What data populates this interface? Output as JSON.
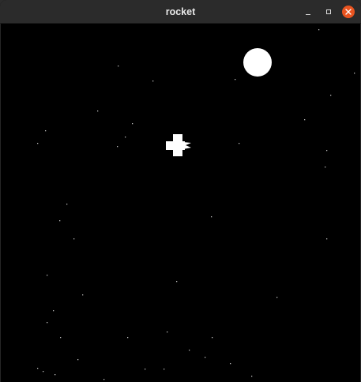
{
  "window": {
    "title": "rocket",
    "controls": {
      "minimize_icon": "minimize-icon",
      "maximize_icon": "maximize-icon",
      "close_icon": "close-icon"
    },
    "close_color": "#e95420"
  },
  "game": {
    "background_color": "#000000",
    "object_color": "#ffffff"
  }
}
